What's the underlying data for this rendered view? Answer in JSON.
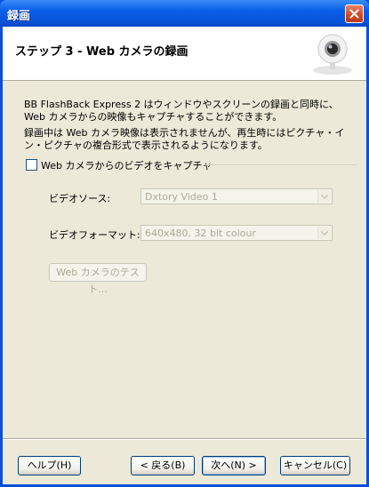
{
  "window": {
    "title": "録画",
    "close_icon": "close-icon"
  },
  "header": {
    "title": "ステップ 3 - Web カメラの録画",
    "icon": "webcam-icon"
  },
  "description": {
    "paragraph1": "BB FlashBack Express 2 はウィンドウやスクリーンの録画と同時に、Web カメラからの映像もキャプチャすることができます。",
    "paragraph2": "録画中は Web カメラ映像は表示されませんが、再生時にはピクチャ・イン・ピクチャの複合形式で表示されるようになります。"
  },
  "capture": {
    "label": "Web カメラからのビデオをキャプチャ",
    "checked": false
  },
  "video_source": {
    "label": "ビデオソース:",
    "value": "Dxtory Video 1"
  },
  "video_format": {
    "label": "ビデオフォーマット:",
    "value": "640x480, 32 bit colour"
  },
  "test_button": {
    "label": "Web カメラのテスト..."
  },
  "buttons": {
    "help": "ヘルプ(H)",
    "back": "< 戻る(B)",
    "next": "次へ(N) >",
    "cancel": "キャンセル(C)"
  },
  "colors": {
    "titlebar": "#0a5fe8",
    "dialog_bg": "#ece9d8",
    "disabled_text": "#aca899"
  }
}
